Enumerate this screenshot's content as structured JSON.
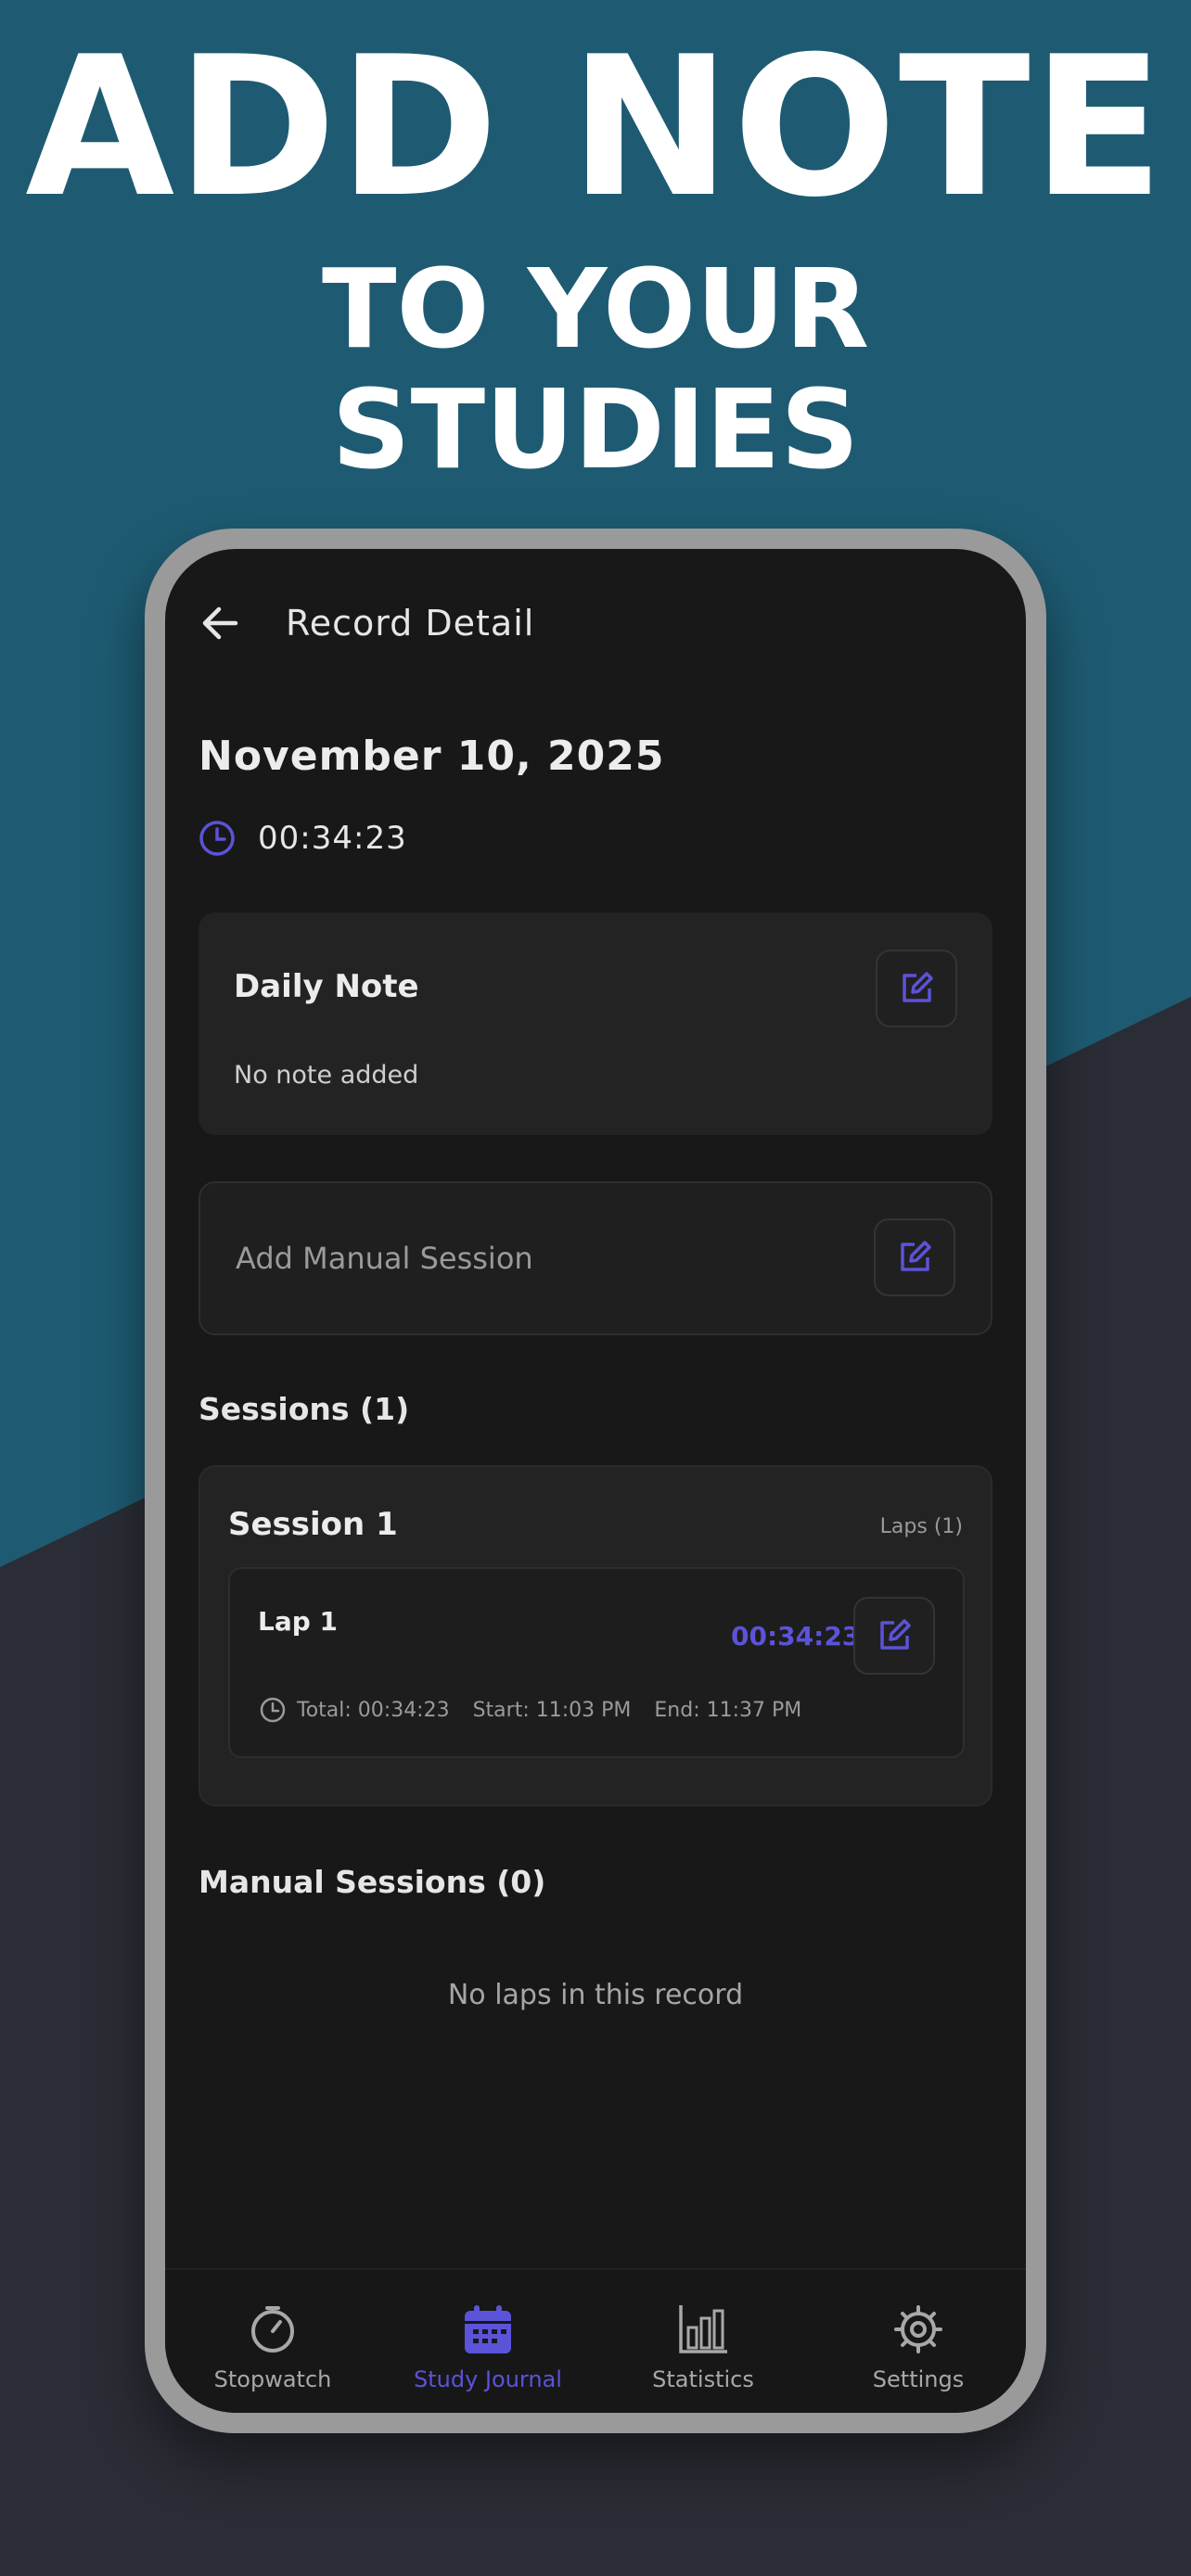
{
  "promo": {
    "line1": "ADD NOTE",
    "line2": "TO YOUR",
    "line3": "STUDIES"
  },
  "appbar": {
    "back_icon": "arrow-left-icon",
    "title": "Record Detail"
  },
  "record": {
    "date": "November 10, 2025",
    "duration_icon": "clock-icon",
    "duration": "00:34:23"
  },
  "daily_note": {
    "title": "Daily Note",
    "body": "No note added",
    "edit_icon": "edit-icon"
  },
  "manual_session": {
    "label": "Add Manual Session",
    "edit_icon": "edit-icon"
  },
  "sessions": {
    "header": "Sessions (1)",
    "items": [
      {
        "title": "Session 1",
        "laps_count": "Laps (1)",
        "laps": [
          {
            "title": "Lap 1",
            "time": "00:34:23",
            "total": "Total: 00:34:23",
            "start": "Start: 11:03 PM",
            "end": "End: 11:37 PM"
          }
        ]
      }
    ]
  },
  "manual_sessions": {
    "header": "Manual Sessions (0)",
    "empty_text": "No laps in this record"
  },
  "nav": {
    "items": [
      {
        "label": "Stopwatch",
        "icon": "stopwatch-icon"
      },
      {
        "label": "Study Journal",
        "icon": "calendar-icon",
        "active": true
      },
      {
        "label": "Statistics",
        "icon": "bar-chart-icon"
      },
      {
        "label": "Settings",
        "icon": "gear-icon"
      }
    ]
  },
  "colors": {
    "accent": "#5b53d8",
    "background_top": "#1e5b72",
    "background_bottom": "#2a2d35",
    "screen": "#181818",
    "card": "#232323"
  }
}
